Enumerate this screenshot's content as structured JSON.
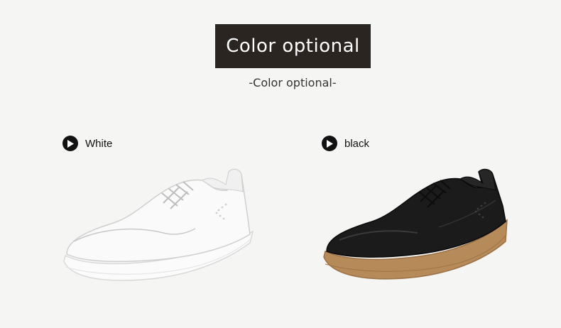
{
  "title": "Color optional",
  "subtitle": "-Color optional-",
  "variants": [
    {
      "label": "White",
      "icon": "play-icon",
      "color": "#ffffff"
    },
    {
      "label": "black",
      "icon": "play-icon",
      "color": "#111111"
    }
  ],
  "colors": {
    "background": "#f5f5f4",
    "title_box": "#2b2522",
    "black_shoe_sole": "#b78a5a"
  }
}
